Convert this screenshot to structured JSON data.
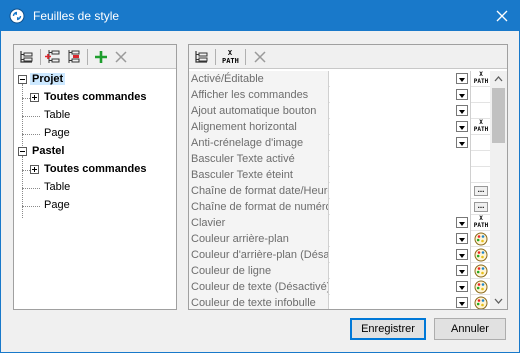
{
  "window": {
    "title": "Feuilles de style"
  },
  "left_toolbar": {
    "icons": [
      "tree-view-icon",
      "add-child-icon",
      "remove-child-icon",
      "add-icon",
      "delete-icon"
    ]
  },
  "tree": {
    "nodes": [
      {
        "label": "Projet",
        "level": 0,
        "bold": true,
        "expander": "minus",
        "selected": true
      },
      {
        "label": "Toutes commandes",
        "level": 1,
        "bold": true,
        "expander": "plus"
      },
      {
        "label": "Table",
        "level": 1,
        "bold": false
      },
      {
        "label": "Page",
        "level": 1,
        "bold": false
      },
      {
        "label": "Pastel",
        "level": 0,
        "bold": true,
        "expander": "minus"
      },
      {
        "label": "Toutes commandes",
        "level": 1,
        "bold": true,
        "expander": "plus"
      },
      {
        "label": "Table",
        "level": 1,
        "bold": false
      },
      {
        "label": "Page",
        "level": 1,
        "bold": false
      }
    ]
  },
  "right_toolbar": {
    "icons": [
      "tree-view-icon",
      "xpath-icon",
      "delete-icon"
    ],
    "xpath_label": "X PATH"
  },
  "properties": [
    {
      "name": "Activé/Éditable",
      "editor": "dropdown",
      "extra": "xpath"
    },
    {
      "name": "Afficher les commandes",
      "editor": "dropdown",
      "extra": ""
    },
    {
      "name": "Ajout automatique bouton",
      "editor": "dropdown",
      "extra": ""
    },
    {
      "name": "Alignement horizontal",
      "editor": "dropdown",
      "extra": "xpath"
    },
    {
      "name": "Anti-crénelage d'image",
      "editor": "dropdown",
      "extra": ""
    },
    {
      "name": "Basculer Texte activé",
      "editor": "none",
      "extra": ""
    },
    {
      "name": "Basculer Texte éteint",
      "editor": "none",
      "extra": ""
    },
    {
      "name": "Chaîne de format date/Heure",
      "editor": "none",
      "extra": "ellipsis"
    },
    {
      "name": "Chaîne de format de numéro",
      "editor": "none",
      "extra": "ellipsis"
    },
    {
      "name": "Clavier",
      "editor": "dropdown",
      "extra": "xpath"
    },
    {
      "name": "Couleur arrière-plan",
      "editor": "dropdown",
      "extra": "palette"
    },
    {
      "name": "Couleur d'arrière-plan (Désactivé)",
      "editor": "dropdown",
      "extra": "palette"
    },
    {
      "name": "Couleur de ligne",
      "editor": "dropdown",
      "extra": "palette"
    },
    {
      "name": "Couleur de texte (Désactivé)",
      "editor": "dropdown",
      "extra": "palette"
    },
    {
      "name": "Couleur de texte infobulle",
      "editor": "dropdown",
      "extra": "palette"
    }
  ],
  "ellipsis_label": "...",
  "buttons": {
    "save": "Enregistrer",
    "cancel": "Annuler"
  },
  "colors": {
    "titlebar": "#1979ca",
    "selection": "#cce8ff",
    "add_green": "#1e9e2e"
  }
}
